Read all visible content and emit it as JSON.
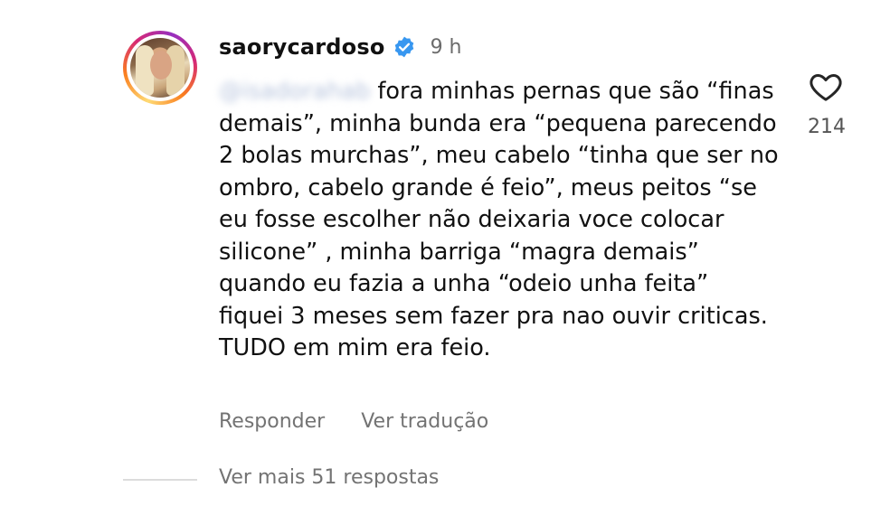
{
  "comment": {
    "username": "saorycardoso",
    "time": "9 h",
    "mention": "@isadorahab",
    "text": "fora minhas pernas que são “finas demais”, minha bunda era “pequena parecendo 2 bolas murchas”, meu cabelo “tinha que ser no ombro, cabelo grande é feio”, meus peitos “se eu fosse escolher não deixaria voce colocar silicone” , minha barriga “magra demais” quando eu fazia a unha “odeio unha feita” fiquei 3 meses sem fazer pra nao ouvir criticas. TUDO em mim era feio.",
    "likes": "214",
    "reply_label": "Responder",
    "translate_label": "Ver tradução",
    "more_replies_label": "Ver mais 51 respostas"
  },
  "icons": {
    "verified": "verified-badge-icon",
    "like": "heart-outline-icon"
  },
  "colors": {
    "verified_blue": "#3897f0",
    "muted_text": "#737373"
  }
}
